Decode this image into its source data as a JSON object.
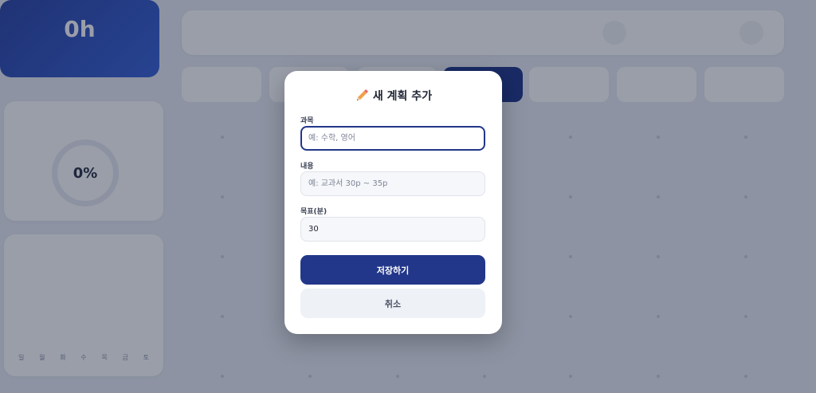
{
  "modal": {
    "title": "새 계획 추가",
    "title_icon": "pencil-icon",
    "subject": {
      "label": "과목",
      "placeholder": "예: 수학, 영어",
      "value": ""
    },
    "content": {
      "label": "내용",
      "placeholder": "예: 교과서 30p ~ 35p",
      "value": ""
    },
    "goal": {
      "label": "목표(분)",
      "value": "30"
    },
    "save_label": "저장하기",
    "cancel_label": "취소"
  },
  "background": {
    "hero": {
      "value": "0h"
    },
    "rate": {
      "percent": "0%"
    },
    "week_days": [
      "일",
      "월",
      "화",
      "수",
      "목",
      "금",
      "토"
    ]
  },
  "colors": {
    "primary": "#22378a",
    "overlay": "rgba(15,25,50,0.42)",
    "sunday": "#e35454",
    "saturday": "#3a63d6"
  }
}
